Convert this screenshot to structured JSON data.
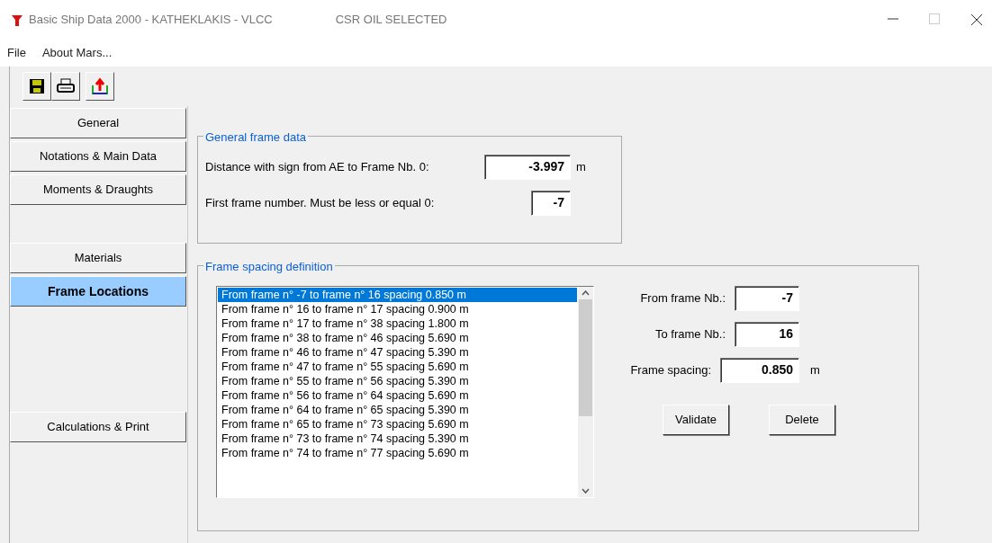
{
  "window": {
    "title": "Basic Ship Data 2000 - KATHEKLAKIS - VLCC",
    "status": "CSR OIL SELECTED"
  },
  "menu": [
    "File",
    "About Mars..."
  ],
  "sidebar": {
    "groups": [
      [
        {
          "label": "General",
          "selected": false
        },
        {
          "label": "Notations & Main Data",
          "selected": false
        },
        {
          "label": "Moments & Draughts",
          "selected": false
        }
      ],
      [
        {
          "label": "Materials",
          "selected": false
        },
        {
          "label": "Frame Locations",
          "selected": true
        }
      ],
      [
        {
          "label": "Calculations & Print",
          "selected": false
        }
      ]
    ]
  },
  "general_frame_data": {
    "title": "General frame data",
    "fields": [
      {
        "label": "Distance with sign from AE to Frame Nb. 0:",
        "value": "-3.997",
        "unit": "m"
      },
      {
        "label": "First frame number. Must be less or equal 0:",
        "value": "-7"
      }
    ]
  },
  "frame_spacing": {
    "title": "Frame spacing definition",
    "list": [
      {
        "text": "From frame n° -7 to frame n° 16 spacing 0.850 m",
        "selected": true
      },
      {
        "text": "From frame n° 16 to frame n° 17 spacing 0.900 m",
        "selected": false
      },
      {
        "text": "From frame n° 17 to frame n° 38 spacing 1.800 m",
        "selected": false
      },
      {
        "text": "From frame n° 38 to frame n° 46 spacing 5.690 m",
        "selected": false
      },
      {
        "text": "From frame n° 46 to frame n° 47 spacing 5.390 m",
        "selected": false
      },
      {
        "text": "From frame n° 47 to frame n° 55 spacing 5.690 m",
        "selected": false
      },
      {
        "text": "From frame n° 55 to frame n° 56 spacing 5.390 m",
        "selected": false
      },
      {
        "text": "From frame n° 56 to frame n° 64 spacing 5.690 m",
        "selected": false
      },
      {
        "text": "From frame n° 64 to frame n° 65 spacing 5.390 m",
        "selected": false
      },
      {
        "text": "From frame n° 65 to frame n° 73 spacing 5.690 m",
        "selected": false
      },
      {
        "text": "From frame n° 73 to frame n° 74 spacing 5.390 m",
        "selected": false
      },
      {
        "text": "From frame n° 74 to frame n° 77 spacing 5.690 m",
        "selected": false
      }
    ],
    "fields": [
      {
        "label": "From frame Nb.:",
        "value": "-7"
      },
      {
        "label": "To frame Nb.:",
        "value": "16"
      },
      {
        "label": "Frame spacing:",
        "value": "0.850",
        "unit": "m"
      }
    ],
    "buttons": [
      "Validate",
      "Delete"
    ]
  }
}
